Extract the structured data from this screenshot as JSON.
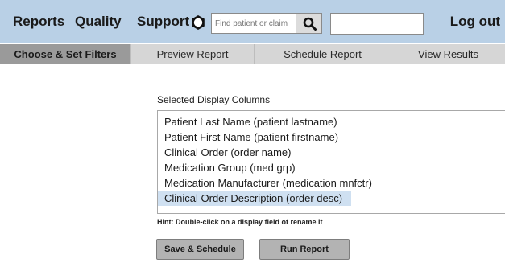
{
  "topbar": {
    "nav": [
      "Reports",
      "Quality",
      "Support"
    ],
    "search_placeholder": "Find patient or claim",
    "logout_label": "Log out",
    "icons": {
      "settings": "gear-icon",
      "search": "search-icon"
    },
    "background_color": "#b9d0e6"
  },
  "tabs": [
    {
      "label": "Choose & Set Filters",
      "active": true
    },
    {
      "label": "Preview Report",
      "active": false
    },
    {
      "label": "Schedule Report",
      "active": false
    },
    {
      "label": "View Results",
      "active": false
    }
  ],
  "main": {
    "columns_label": "Selected Display Columns",
    "columns": [
      "Patient Last Name (patient lastname)",
      "Patient First Name (patient firstname)",
      "Clinical Order (order name)",
      "Medication Group (med grp)",
      "Medication Manufacturer (medication mnfctr)",
      "Clinical Order Description (order desc)"
    ],
    "selected_column_index": 5,
    "selection_color": "#cfe0f1",
    "hint": "Hint: Double-click on a display field ot rename it",
    "save_schedule_label": "Save & Schedule",
    "run_report_label": "Run Report"
  }
}
